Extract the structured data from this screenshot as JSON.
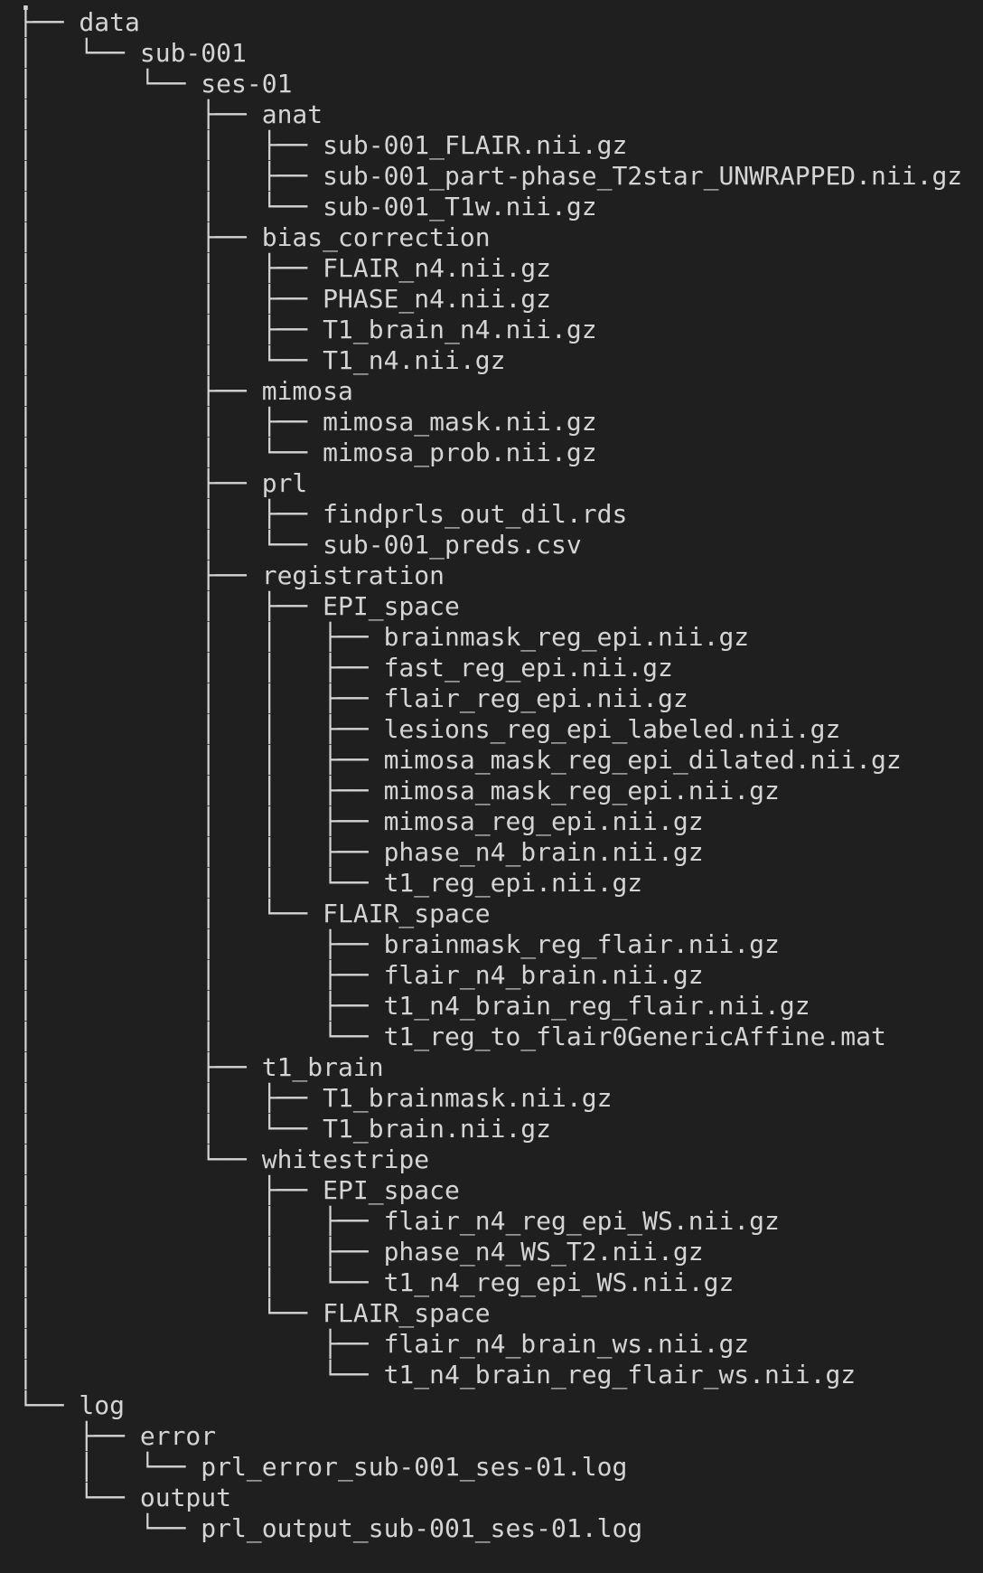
{
  "tree": {
    "root": ".",
    "lines": [
      "├── data",
      "│   └── sub-001",
      "│       └── ses-01",
      "│           ├── anat",
      "│           │   ├── sub-001_FLAIR.nii.gz",
      "│           │   ├── sub-001_part-phase_T2star_UNWRAPPED.nii.gz",
      "│           │   └── sub-001_T1w.nii.gz",
      "│           ├── bias_correction",
      "│           │   ├── FLAIR_n4.nii.gz",
      "│           │   ├── PHASE_n4.nii.gz",
      "│           │   ├── T1_brain_n4.nii.gz",
      "│           │   └── T1_n4.nii.gz",
      "│           ├── mimosa",
      "│           │   ├── mimosa_mask.nii.gz",
      "│           │   └── mimosa_prob.nii.gz",
      "│           ├── prl",
      "│           │   ├── findprls_out_dil.rds",
      "│           │   └── sub-001_preds.csv",
      "│           ├── registration",
      "│           │   ├── EPI_space",
      "│           │   │   ├── brainmask_reg_epi.nii.gz",
      "│           │   │   ├── fast_reg_epi.nii.gz",
      "│           │   │   ├── flair_reg_epi.nii.gz",
      "│           │   │   ├── lesions_reg_epi_labeled.nii.gz",
      "│           │   │   ├── mimosa_mask_reg_epi_dilated.nii.gz",
      "│           │   │   ├── mimosa_mask_reg_epi.nii.gz",
      "│           │   │   ├── mimosa_reg_epi.nii.gz",
      "│           │   │   ├── phase_n4_brain.nii.gz",
      "│           │   │   └── t1_reg_epi.nii.gz",
      "│           │   └── FLAIR_space",
      "│           │       ├── brainmask_reg_flair.nii.gz",
      "│           │       ├── flair_n4_brain.nii.gz",
      "│           │       ├── t1_n4_brain_reg_flair.nii.gz",
      "│           │       └── t1_reg_to_flair0GenericAffine.mat",
      "│           ├── t1_brain",
      "│           │   ├── T1_brainmask.nii.gz",
      "│           │   └── T1_brain.nii.gz",
      "│           └── whitestripe",
      "│               ├── EPI_space",
      "│               │   ├── flair_n4_reg_epi_WS.nii.gz",
      "│               │   ├── phase_n4_WS_T2.nii.gz",
      "│               │   └── t1_n4_reg_epi_WS.nii.gz",
      "│               └── FLAIR_space",
      "│                   ├── flair_n4_brain_ws.nii.gz",
      "│                   └── t1_n4_brain_reg_flair_ws.nii.gz",
      "└── log",
      "    ├── error",
      "    │   └── prl_error_sub-001_ses-01.log",
      "    └── output",
      "        └── prl_output_sub-001_ses-01.log"
    ]
  }
}
